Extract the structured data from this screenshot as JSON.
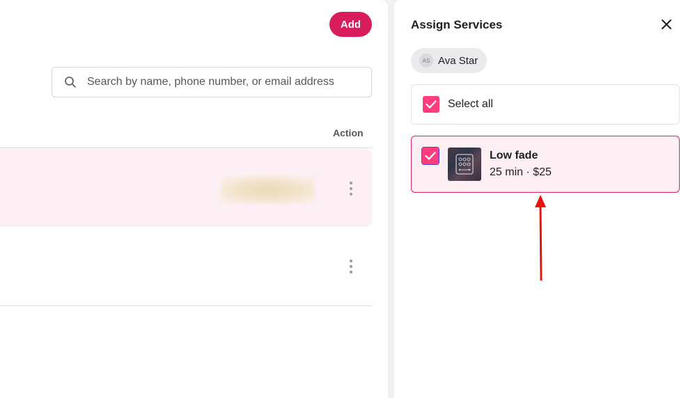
{
  "toolbar": {
    "add_label": "Add"
  },
  "search": {
    "placeholder": "Search by name, phone number, or email address",
    "icon": "search-icon"
  },
  "table": {
    "columns": {
      "action": "Action"
    },
    "rows": [
      {
        "highlighted": true,
        "cell": "(blurred)"
      },
      {
        "highlighted": false
      }
    ]
  },
  "assign_panel": {
    "title": "Assign Services",
    "close_icon": "close-icon",
    "staff": {
      "initials": "AS",
      "name": "Ava Star"
    },
    "select_all": {
      "label": "Select all",
      "checked": true
    },
    "services": [
      {
        "name": "Low fade",
        "meta": "25 min · $25",
        "checked": true
      }
    ]
  },
  "colors": {
    "accent": "#d91c5c",
    "checkbox": "#ff3d7f",
    "selected_bg": "#fdeff4",
    "annotation_arrow": "#e8130f"
  }
}
